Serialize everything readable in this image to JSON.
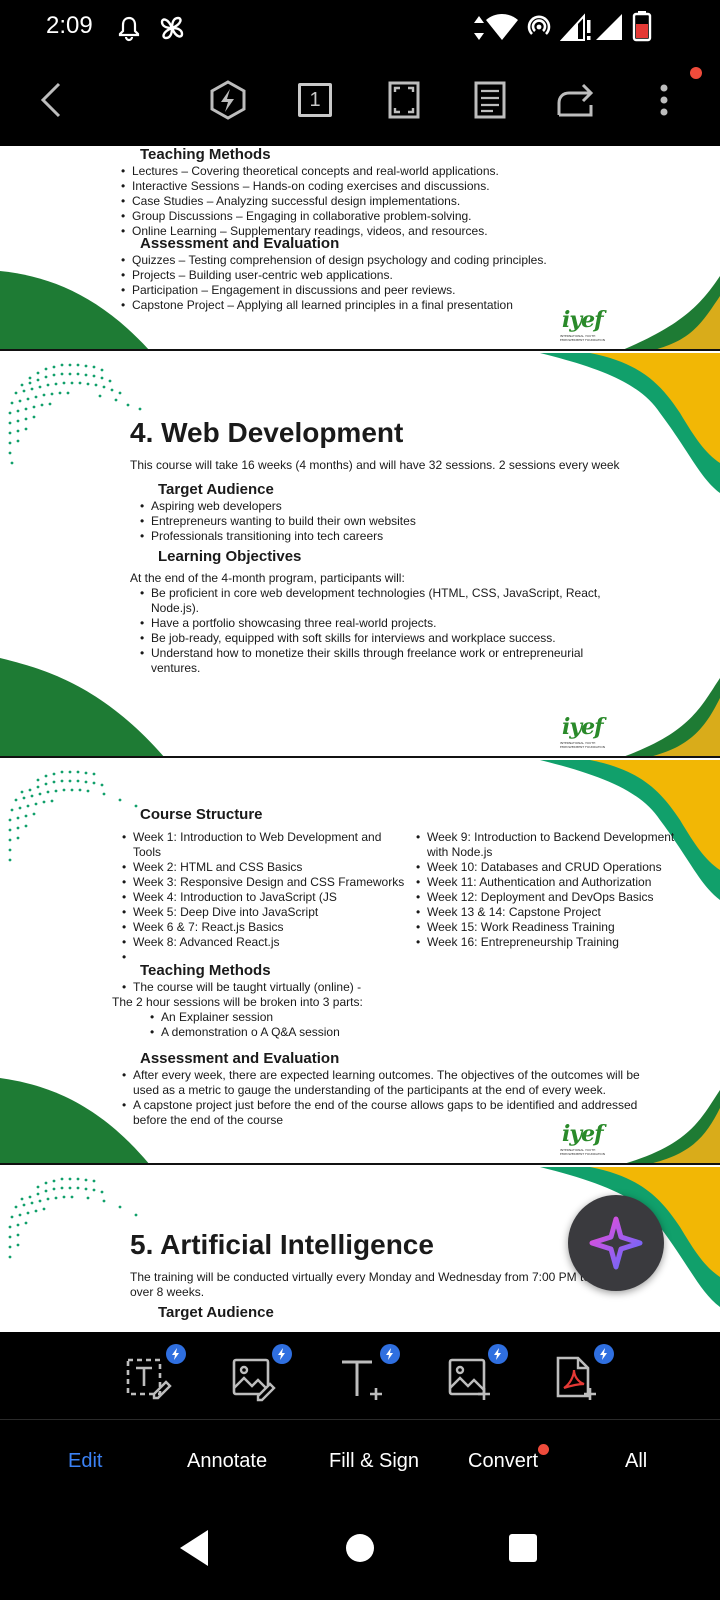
{
  "status_bar": {
    "time": "2:09"
  },
  "colors": {
    "green": "#1e7b34",
    "teal": "#11a06b",
    "gold": "#f2b705",
    "accent_blue": "#3b82f6",
    "red_dot": "#ef4b3b"
  },
  "top_toolbar": {
    "icons": [
      "back-icon",
      "ai-bolt-icon",
      "page-number-icon",
      "fullscreen-icon",
      "reading-mode-icon",
      "share-icon",
      "more-icon"
    ],
    "page_number": "1"
  },
  "doc": {
    "page1": {
      "teaching_methods_heading": "Teaching Methods",
      "teaching_methods": [
        "Lectures – Covering theoretical concepts and real-world applications.",
        "Interactive Sessions – Hands-on coding exercises and discussions.",
        "Case Studies – Analyzing successful design implementations.",
        "Group Discussions – Engaging in collaborative problem-solving.",
        "Online Learning – Supplementary readings, videos, and resources."
      ],
      "assessment_heading": "Assessment and Evaluation",
      "assessment": [
        "Quizzes – Testing comprehension of design psychology and coding principles.",
        "Projects – Building user-centric web applications.",
        "Participation – Engagement in discussions and peer reviews.",
        "Capstone Project – Applying all learned principles in a final presentation"
      ]
    },
    "page2": {
      "title": "4. Web Development",
      "intro": "This course will take 16 weeks (4 months) and will have 32 sessions. 2 sessions every week",
      "audience_heading": "Target Audience",
      "audience": [
        "Aspiring web developers",
        "Entrepreneurs wanting to build their own websites",
        "Professionals transitioning into tech careers"
      ],
      "objectives_heading": "Learning Objectives",
      "objectives_intro": "At the end of the 4-month program, participants will:",
      "objectives": [
        "Be proficient in core web development technologies (HTML, CSS, JavaScript, React, Node.js).",
        "Have a portfolio showcasing three real-world projects.",
        "Be job-ready, equipped with soft skills for interviews and workplace success.",
        "Understand how to monetize their skills through freelance work or entrepreneurial ventures."
      ]
    },
    "page3": {
      "structure_heading": "Course Structure",
      "weeks_left": [
        "Week 1: Introduction to Web Development and Tools",
        "Week 2: HTML and CSS Basics",
        "Week 3: Responsive Design and CSS Frameworks",
        "Week 4: Introduction to JavaScript (JS",
        "Week 5: Deep Dive into JavaScript",
        "Week 6 & 7: React.js Basics",
        "Week 8: Advanced React.js",
        ""
      ],
      "weeks_right": [
        "Week 9: Introduction to Backend Development with Node.js",
        "Week 10: Databases and CRUD Operations",
        "Week 11: Authentication and Authorization",
        "Week 12: Deployment and DevOps Basics",
        "Week 13 & 14: Capstone Project",
        "Week 15: Work Readiness Training",
        "Week 16: Entrepreneurship Training"
      ],
      "teaching_heading": "Teaching Methods",
      "teaching_line1": "The course will be taught virtually (online) -",
      "teaching_line2": "The 2 hour sessions will be broken into 3 parts:",
      "teaching_parts": [
        "An Explainer session",
        "A demonstration o A Q&A session"
      ],
      "assessment_heading": "Assessment and Evaluation",
      "assessment": [
        "After every week, there are expected learning outcomes. The objectives of the outcomes will be used as a metric to gauge the understanding of the participants at the end of every week.",
        " A capstone project just before the end of the course allows gaps to be identified and addressed before the end of the course"
      ]
    },
    "page4": {
      "title": "5. Artificial Intelligence",
      "intro": "The training will be conducted virtually every Monday and Wednesday from 7:00 PM to 9:00 PM over 8 weeks.",
      "audience_heading": "Target Audience"
    },
    "logo": {
      "text": "iyef",
      "subtitle": "INTERNATIONAL YOUTH EMPOWERMENT FOUNDATION"
    }
  },
  "fab": {
    "icon": "ai-assistant-icon"
  },
  "tools": [
    {
      "name": "edit-text-tool",
      "icon": "edit-text-icon"
    },
    {
      "name": "edit-image-tool",
      "icon": "edit-image-icon"
    },
    {
      "name": "add-text-tool",
      "icon": "add-text-icon"
    },
    {
      "name": "add-image-tool",
      "icon": "add-image-icon"
    },
    {
      "name": "add-pdf-tool",
      "icon": "add-pdf-icon"
    }
  ],
  "tabs": {
    "edit": "Edit",
    "annotate": "Annotate",
    "fill_sign": "Fill & Sign",
    "convert": "Convert",
    "all": "All"
  },
  "nav": {
    "icons": [
      "back-triangle-icon",
      "home-circle-icon",
      "recents-square-icon"
    ]
  }
}
